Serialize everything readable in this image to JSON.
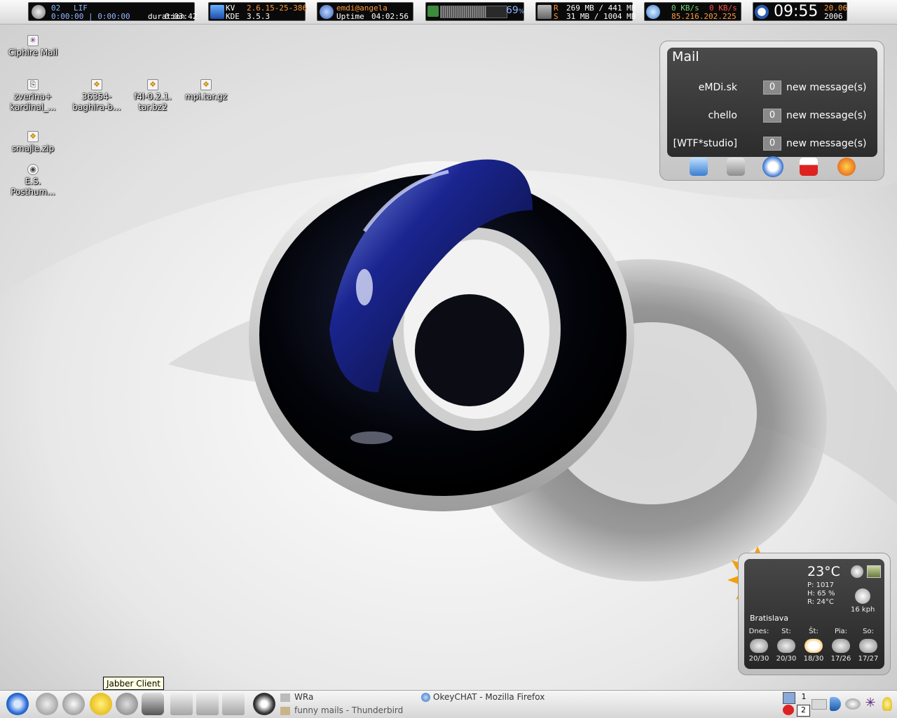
{
  "topbar": {
    "music": {
      "track": "02",
      "title": "LIF",
      "time": "0:00:00 | 0:00:00",
      "duration_label": "duration",
      "duration": "0:03:42"
    },
    "system": {
      "host_label": "KV",
      "kernel": "2.6.15-25-386",
      "desktop_label": "KDE",
      "desktop_version": "3.5.3"
    },
    "user": {
      "name": "emdi@angela",
      "uptime_label": "Uptime",
      "uptime": "04:02:56"
    },
    "cpu": {
      "percent_value": "69",
      "percent_unit": "%",
      "load": 0.69
    },
    "memory": {
      "ram_label": "R",
      "ram": "269 MB / 441 MB",
      "swap_label": "S",
      "swap": "31 MB / 1004 MB"
    },
    "network": {
      "down": "0 KB/s",
      "up": "0 KB/s",
      "ip": "85.216.202.225"
    },
    "clock": {
      "time": "09:55",
      "date": "20.06",
      "year": "2006"
    }
  },
  "desktop_icons": [
    {
      "label": "Ciphire Mail",
      "label2": ""
    },
    {
      "label": "zverina+",
      "label2": "kardinal_..."
    },
    {
      "label": "36354-",
      "label2": "baghira-b..."
    },
    {
      "label": "f4l-0.2.1.",
      "label2": "tar.bz2"
    },
    {
      "label": "mpi.tar.gz",
      "label2": ""
    },
    {
      "label": "smajle.zip",
      "label2": ""
    },
    {
      "label": "E.S.",
      "label2": "Posthum..."
    }
  ],
  "mail": {
    "title": "Mail",
    "accounts": [
      {
        "name": "eMDi.sk",
        "count": "0",
        "suffix": "new message(s)"
      },
      {
        "name": "chello",
        "count": "0",
        "suffix": "new message(s)"
      },
      {
        "name": "[WTF*studio]",
        "count": "0",
        "suffix": "new message(s)"
      }
    ],
    "dock_icons": [
      "computer-icon",
      "hard-drive-icon",
      "email-icon",
      "calendar-icon",
      "firefox-icon"
    ]
  },
  "weather": {
    "temp": "23°C",
    "pressure": "P: 1017",
    "humidity": "H: 65 %",
    "realfeel": "R: 24°C",
    "wind": "16 kph",
    "city": "Bratislava",
    "forecast": [
      {
        "day": "Dnes:",
        "range": "20/30"
      },
      {
        "day": "St:",
        "range": "20/30"
      },
      {
        "day": "Št:",
        "range": "18/30"
      },
      {
        "day": "Pia:",
        "range": "17/26"
      },
      {
        "day": "So:",
        "range": "17/27"
      }
    ]
  },
  "panel": {
    "tooltip": "Jabber Client",
    "tasks": [
      {
        "label": "WRa"
      },
      {
        "label": "funny mails - Thunderbird"
      },
      {
        "label": "OkeyCHAT - Mozilla Firefox"
      }
    ],
    "desktops": [
      "1",
      "2"
    ]
  },
  "colors": {
    "accent_blue": "#8fb6ff",
    "accent_orange": "#ff9a3a",
    "net_green": "#6fd86f",
    "net_red": "#ff4a4a"
  }
}
